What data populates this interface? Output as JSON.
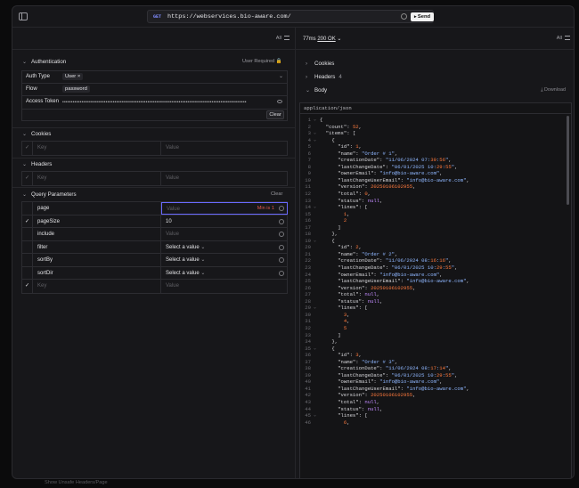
{
  "request": {
    "method": "GET",
    "url": "https://webservices.bio-aware.com/",
    "send_label": "Send"
  },
  "left": {
    "filter_label": "All",
    "auth": {
      "title": "Authentication",
      "user_required": "User Required",
      "type_label": "Auth Type",
      "type_value": "User",
      "flow_label": "Flow",
      "flow_value": "password",
      "token_label": "Access Token",
      "token_value": "••••••••••••••••••••••••••••••••••••••••••••••••••••••••••••••••••••••••••••••••••••••••••••••••••••••••••",
      "clear_label": "Clear"
    },
    "cookies": {
      "title": "Cookies",
      "key_ph": "Key",
      "value_ph": "Value"
    },
    "headers": {
      "title": "Headers",
      "key_ph": "Key",
      "value_ph": "Value"
    },
    "query": {
      "title": "Query Parameters",
      "clear_label": "Clear",
      "rows": [
        {
          "key": "page",
          "value": "Value",
          "warn": "Min is 1"
        },
        {
          "key": "pageSize",
          "value": "10"
        },
        {
          "key": "include",
          "value": "Value"
        },
        {
          "key": "filter",
          "value": "Select a value"
        },
        {
          "key": "sortBy",
          "value": "Select a value"
        },
        {
          "key": "sortDir",
          "value": "Select a value"
        },
        {
          "key": "Key",
          "value": "Value"
        }
      ]
    }
  },
  "right": {
    "time": "77ms",
    "status": "200 OK",
    "filter_label": "All",
    "cookies_label": "Cookies",
    "headers_label": "Headers",
    "headers_count": "4",
    "body_label": "Body",
    "download_label": "Download",
    "content_type": "application/json"
  },
  "footer_note": "Show Unsafe Headers/Page",
  "icons": [
    "sidebar-toggle-icon",
    "settings-icon",
    "send-icon",
    "filter-icon",
    "lock-icon",
    "eye-icon",
    "info-icon",
    "chevron-icon",
    "download-icon"
  ],
  "code_lines": [
    "{",
    "  \"count\": 52,",
    "  \"items\": [",
    "    {",
    "      \"id\": 1,",
    "      \"name\": \"Order # 1\",",
    "      \"creationDate\": \"11/06/2024 07:39:56\",",
    "      \"lastChangeDate\": \"06/01/2025 10:29:55\",",
    "      \"ownerEmail\": \"info@bio-aware.com\",",
    "      \"lastChangeUserEmail\": \"info@bio-aware.com\",",
    "      \"version\": 20250106102955,",
    "      \"total\": 0,",
    "      \"status\": null,",
    "      \"lines\": [",
    "        1,",
    "        2",
    "      ]",
    "    },",
    "    {",
    "      \"id\": 2,",
    "      \"name\": \"Order # 2\",",
    "      \"creationDate\": \"11/06/2024 08:16:16\",",
    "      \"lastChangeDate\": \"06/01/2025 10:29:55\",",
    "      \"ownerEmail\": \"info@bio-aware.com\",",
    "      \"lastChangeUserEmail\": \"info@bio-aware.com\",",
    "      \"version\": 20250106102955,",
    "      \"total\": null,",
    "      \"status\": null,",
    "      \"lines\": [",
    "        3,",
    "        4,",
    "        5",
    "      ]",
    "    },",
    "    {",
    "      \"id\": 3,",
    "      \"name\": \"Order # 3\",",
    "      \"creationDate\": \"11/06/2024 08:17:14\",",
    "      \"lastChangeDate\": \"06/01/2025 10:29:55\",",
    "      \"ownerEmail\": \"info@bio-aware.com\",",
    "      \"lastChangeUserEmail\": \"info@bio-aware.com\",",
    "      \"version\": 20250106102955,",
    "      \"total\": null,",
    "      \"status\": null,",
    "      \"lines\": [",
    "        6,"
  ]
}
